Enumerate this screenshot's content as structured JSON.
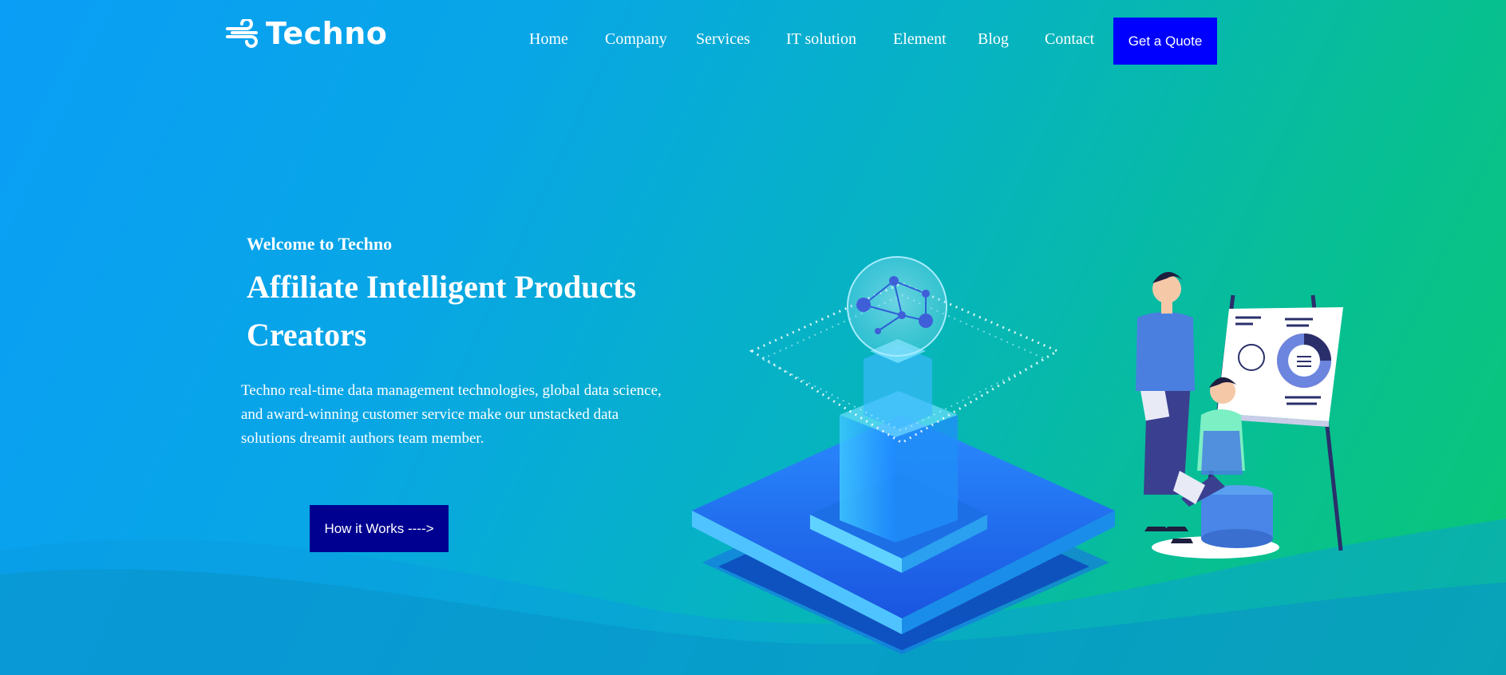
{
  "brand": {
    "name": "Techno"
  },
  "nav": {
    "items": [
      {
        "label": "Home"
      },
      {
        "label": "Company"
      },
      {
        "label": "Services"
      },
      {
        "label": "IT solution"
      },
      {
        "label": "Element"
      },
      {
        "label": "Blog"
      },
      {
        "label": "Contact"
      }
    ],
    "cta_label": "Get a Quote"
  },
  "hero": {
    "welcome": "Welcome to Techno",
    "headline": "Affiliate Intelligent Products Creators",
    "description": "Techno real-time data management technologies, global data science, and award-winning customer service make our unstacked data solutions dreamit authors team member.",
    "button_label": "How it Works ---->"
  },
  "colors": {
    "gradient_start": "#0a9ef6",
    "gradient_end": "#0ac775",
    "cta_bg": "#0000ff",
    "button_bg": "#000090",
    "text": "#ffffff"
  },
  "icons": [
    "wind-logo-icon"
  ]
}
